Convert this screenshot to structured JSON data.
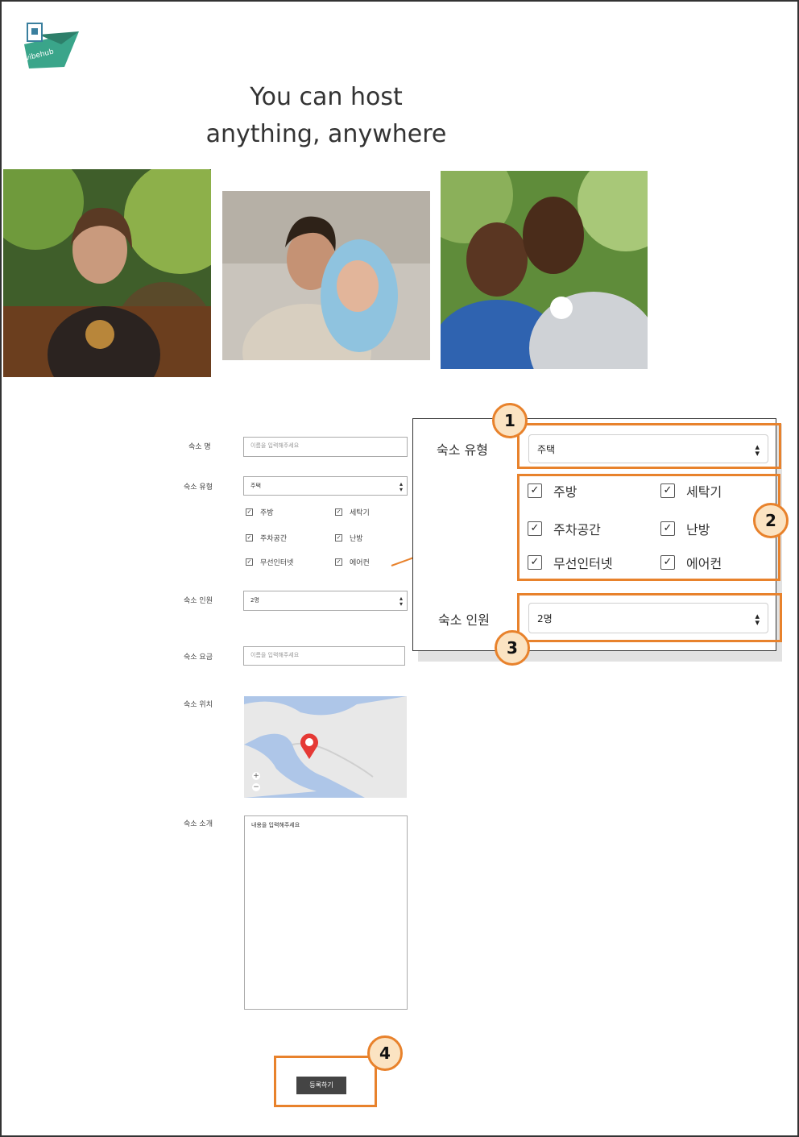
{
  "hero": {
    "title_line1": "You can host",
    "title_line2": "anything, anywhere"
  },
  "form": {
    "name_label": "숙소 명",
    "name_placeholder": "이름을 입력해주세요",
    "type_label": "숙소 유형",
    "type_value": "주택",
    "amenities": [
      {
        "label": "주방",
        "checked": true
      },
      {
        "label": "세탁기",
        "checked": true
      },
      {
        "label": "주차공간",
        "checked": true
      },
      {
        "label": "난방",
        "checked": true
      },
      {
        "label": "무선인터넷",
        "checked": true
      },
      {
        "label": "에어컨",
        "checked": true
      }
    ],
    "capacity_label": "숙소 인원",
    "capacity_value": "2명",
    "price_label": "숙소 요금",
    "price_placeholder": "이름을 입력해주세요",
    "location_label": "숙소 위치",
    "intro_label": "숙소 소개",
    "intro_placeholder": "내용을 입력해주세요",
    "submit_label": "등록하기"
  },
  "zoom_panel": {
    "type_label": "숙소 유형",
    "type_value": "주택",
    "capacity_label": "숙소 인원",
    "capacity_value": "2명"
  },
  "badges": [
    "1",
    "2",
    "3",
    "4"
  ],
  "colors": {
    "highlight": "#e8822c",
    "badge_fill": "#fbe3c2",
    "button": "#444444",
    "map_water": "#aec6e8",
    "map_land": "#e8e8e8",
    "pin": "#e53935"
  }
}
